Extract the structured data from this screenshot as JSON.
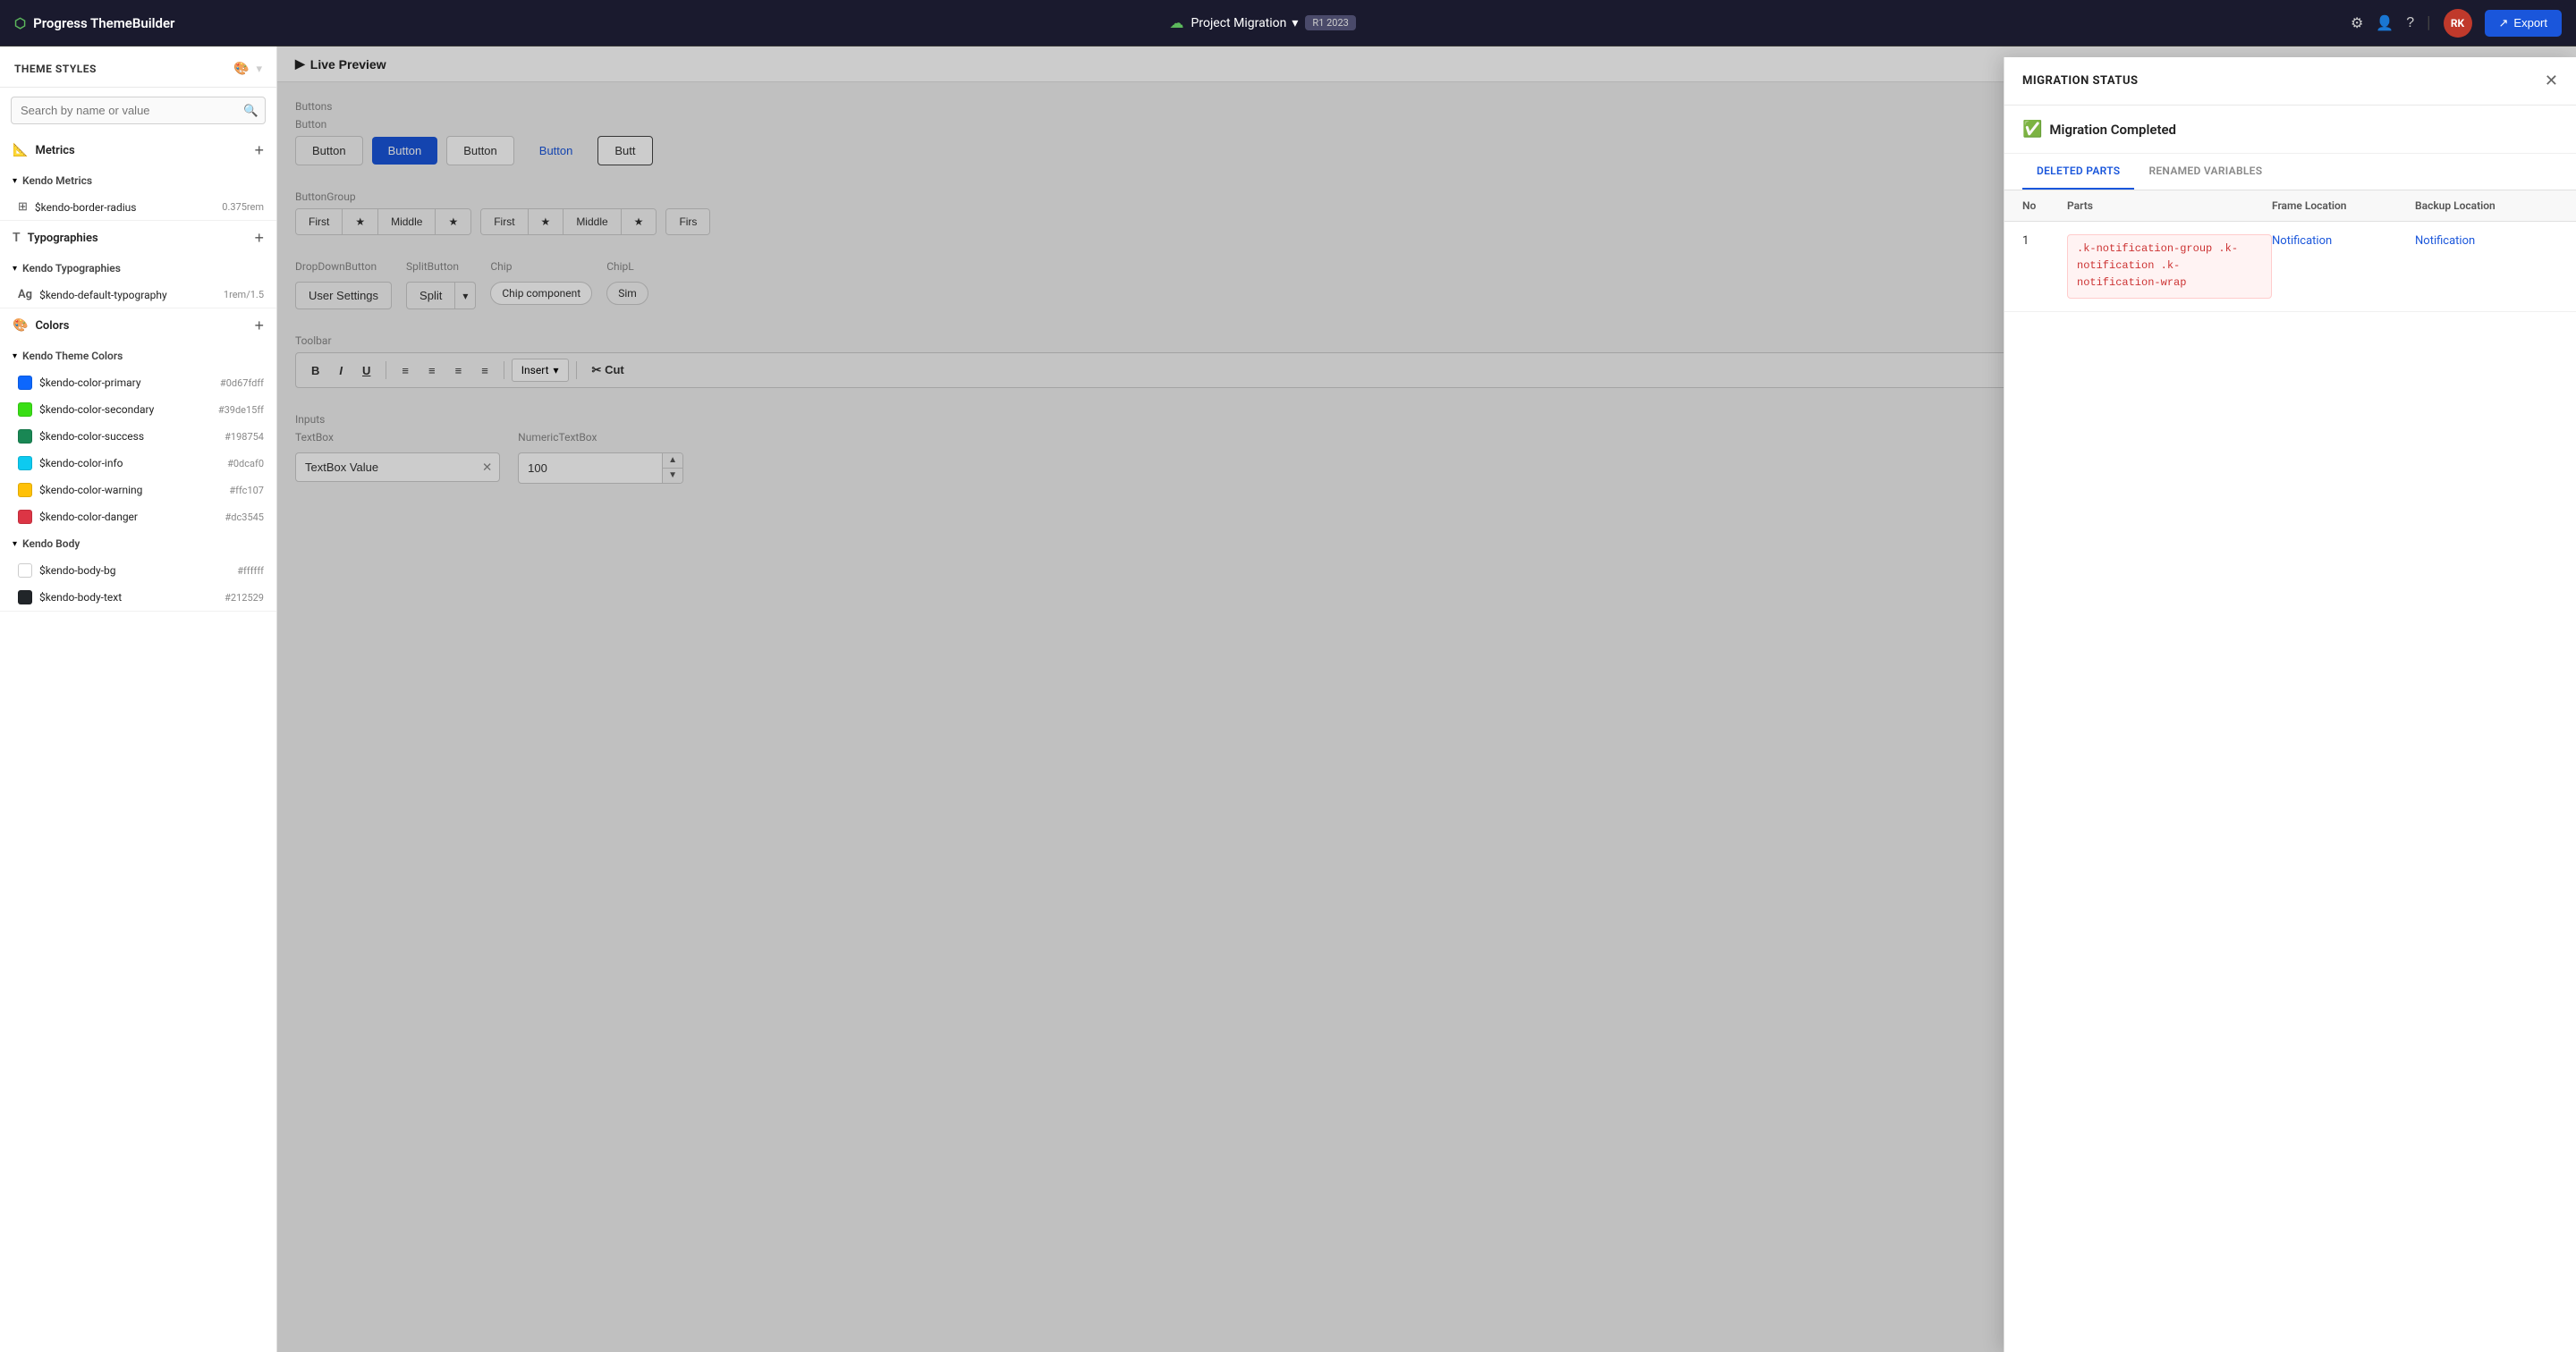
{
  "header": {
    "logo_text": "Progress ThemeBuilder",
    "project_name": "Project Migration",
    "project_badge": "R1 2023",
    "icons": {
      "settings": "⚙",
      "add_user": "👤+",
      "help": "?",
      "chevron_down": "▾",
      "export_icon": "↗"
    },
    "avatar_initials": "RK",
    "export_label": "Export"
  },
  "sidebar": {
    "title": "THEME STYLES",
    "search_placeholder": "Search by name or value",
    "sections": [
      {
        "id": "metrics",
        "label": "Metrics",
        "icon": "📐",
        "expanded": true,
        "subsections": [
          {
            "label": "Kendo Metrics",
            "items": [
              {
                "icon": "border",
                "name": "$kendo-border-radius",
                "value": "0.375rem"
              }
            ]
          }
        ]
      },
      {
        "id": "typographies",
        "label": "Typographies",
        "icon": "T",
        "expanded": true,
        "subsections": [
          {
            "label": "Kendo Typographies",
            "items": [
              {
                "icon": "Ag",
                "name": "$kendo-default-typography",
                "value": "1rem/1.5"
              }
            ]
          }
        ]
      },
      {
        "id": "colors",
        "label": "Colors",
        "icon": "🎨",
        "expanded": true,
        "subsections": [
          {
            "label": "Kendo Theme Colors",
            "items": [
              {
                "color": "#0d67fdff",
                "name": "$kendo-color-primary",
                "value": "#0d67fdff"
              },
              {
                "color": "#39de15ff",
                "name": "$kendo-color-secondary",
                "value": "#39de15ff"
              },
              {
                "color": "#198754",
                "name": "$kendo-color-success",
                "value": "#198754"
              },
              {
                "color": "#0dcaf0",
                "name": "$kendo-color-info",
                "value": "#0dcaf0"
              },
              {
                "color": "#ffc107",
                "name": "$kendo-color-warning",
                "value": "#ffc107"
              },
              {
                "color": "#dc3545",
                "name": "$kendo-color-danger",
                "value": "#dc3545"
              }
            ]
          },
          {
            "label": "Kendo Body",
            "items": [
              {
                "color": "#ffffff",
                "name": "$kendo-body-bg",
                "value": "#ffffff"
              },
              {
                "color": "#212529",
                "name": "$kendo-body-text",
                "value": "#212529"
              }
            ]
          }
        ]
      }
    ]
  },
  "preview": {
    "live_preview_label": "Live Preview",
    "play_icon": "▶"
  },
  "canvas": {
    "sections": [
      {
        "id": "buttons",
        "label": "Buttons",
        "component_label": "Button",
        "buttons": [
          {
            "label": "Button",
            "style": "default"
          },
          {
            "label": "Button",
            "style": "primary"
          },
          {
            "label": "Button",
            "style": "outline"
          },
          {
            "label": "Button",
            "style": "flat"
          },
          {
            "label": "Butt",
            "style": "outline-dark"
          }
        ]
      },
      {
        "id": "buttongroup",
        "label": "ButtonGroup",
        "groups": [
          {
            "items": [
              {
                "label": "First"
              },
              {
                "label": "★",
                "type": "icon"
              },
              {
                "label": "Middle"
              },
              {
                "label": "★",
                "type": "icon"
              }
            ]
          },
          {
            "items": [
              {
                "label": "First"
              },
              {
                "label": "★",
                "type": "icon"
              },
              {
                "label": "Middle"
              },
              {
                "label": "★",
                "type": "icon"
              }
            ]
          },
          {
            "items": [
              {
                "label": "Firs",
                "type": "partial"
              }
            ]
          }
        ]
      },
      {
        "id": "action-components",
        "dropdown_label": "DropDownButton",
        "dropdown_text": "User Settings",
        "split_label": "SplitButton",
        "split_text": "Split",
        "chip_label": "Chip",
        "chip_text": "Chip component",
        "chip_list_label": "ChipL",
        "chip_list_text": "Sim"
      },
      {
        "id": "toolbar",
        "label": "Toolbar",
        "toolbar_buttons": [
          "B",
          "I",
          "U"
        ],
        "toolbar_align": [
          "≡",
          "≡",
          "≡",
          "≡"
        ],
        "toolbar_insert": "Insert",
        "toolbar_cut_icon": "✂",
        "toolbar_cut": "Cut"
      },
      {
        "id": "inputs",
        "label": "Inputs",
        "textbox_label": "TextBox",
        "textbox_value": "TextBox Value",
        "numeric_label": "NumericTextBox",
        "numeric_value": "100"
      }
    ]
  },
  "modal": {
    "title": "MIGRATION STATUS",
    "close_icon": "✕",
    "status_icon": "✅",
    "status_text": "Migration Completed",
    "tabs": [
      {
        "id": "deleted",
        "label": "DELETED PARTS",
        "active": true
      },
      {
        "id": "renamed",
        "label": "RENAMED VARIABLES",
        "active": false
      }
    ],
    "table": {
      "columns": [
        "No",
        "Parts",
        "Frame Location",
        "Backup Location"
      ],
      "rows": [
        {
          "no": "1",
          "parts": ".k-notification-group .k-notification .k-notification-wrap",
          "frame_location": "Notification",
          "backup_location": "Notification"
        }
      ]
    }
  }
}
